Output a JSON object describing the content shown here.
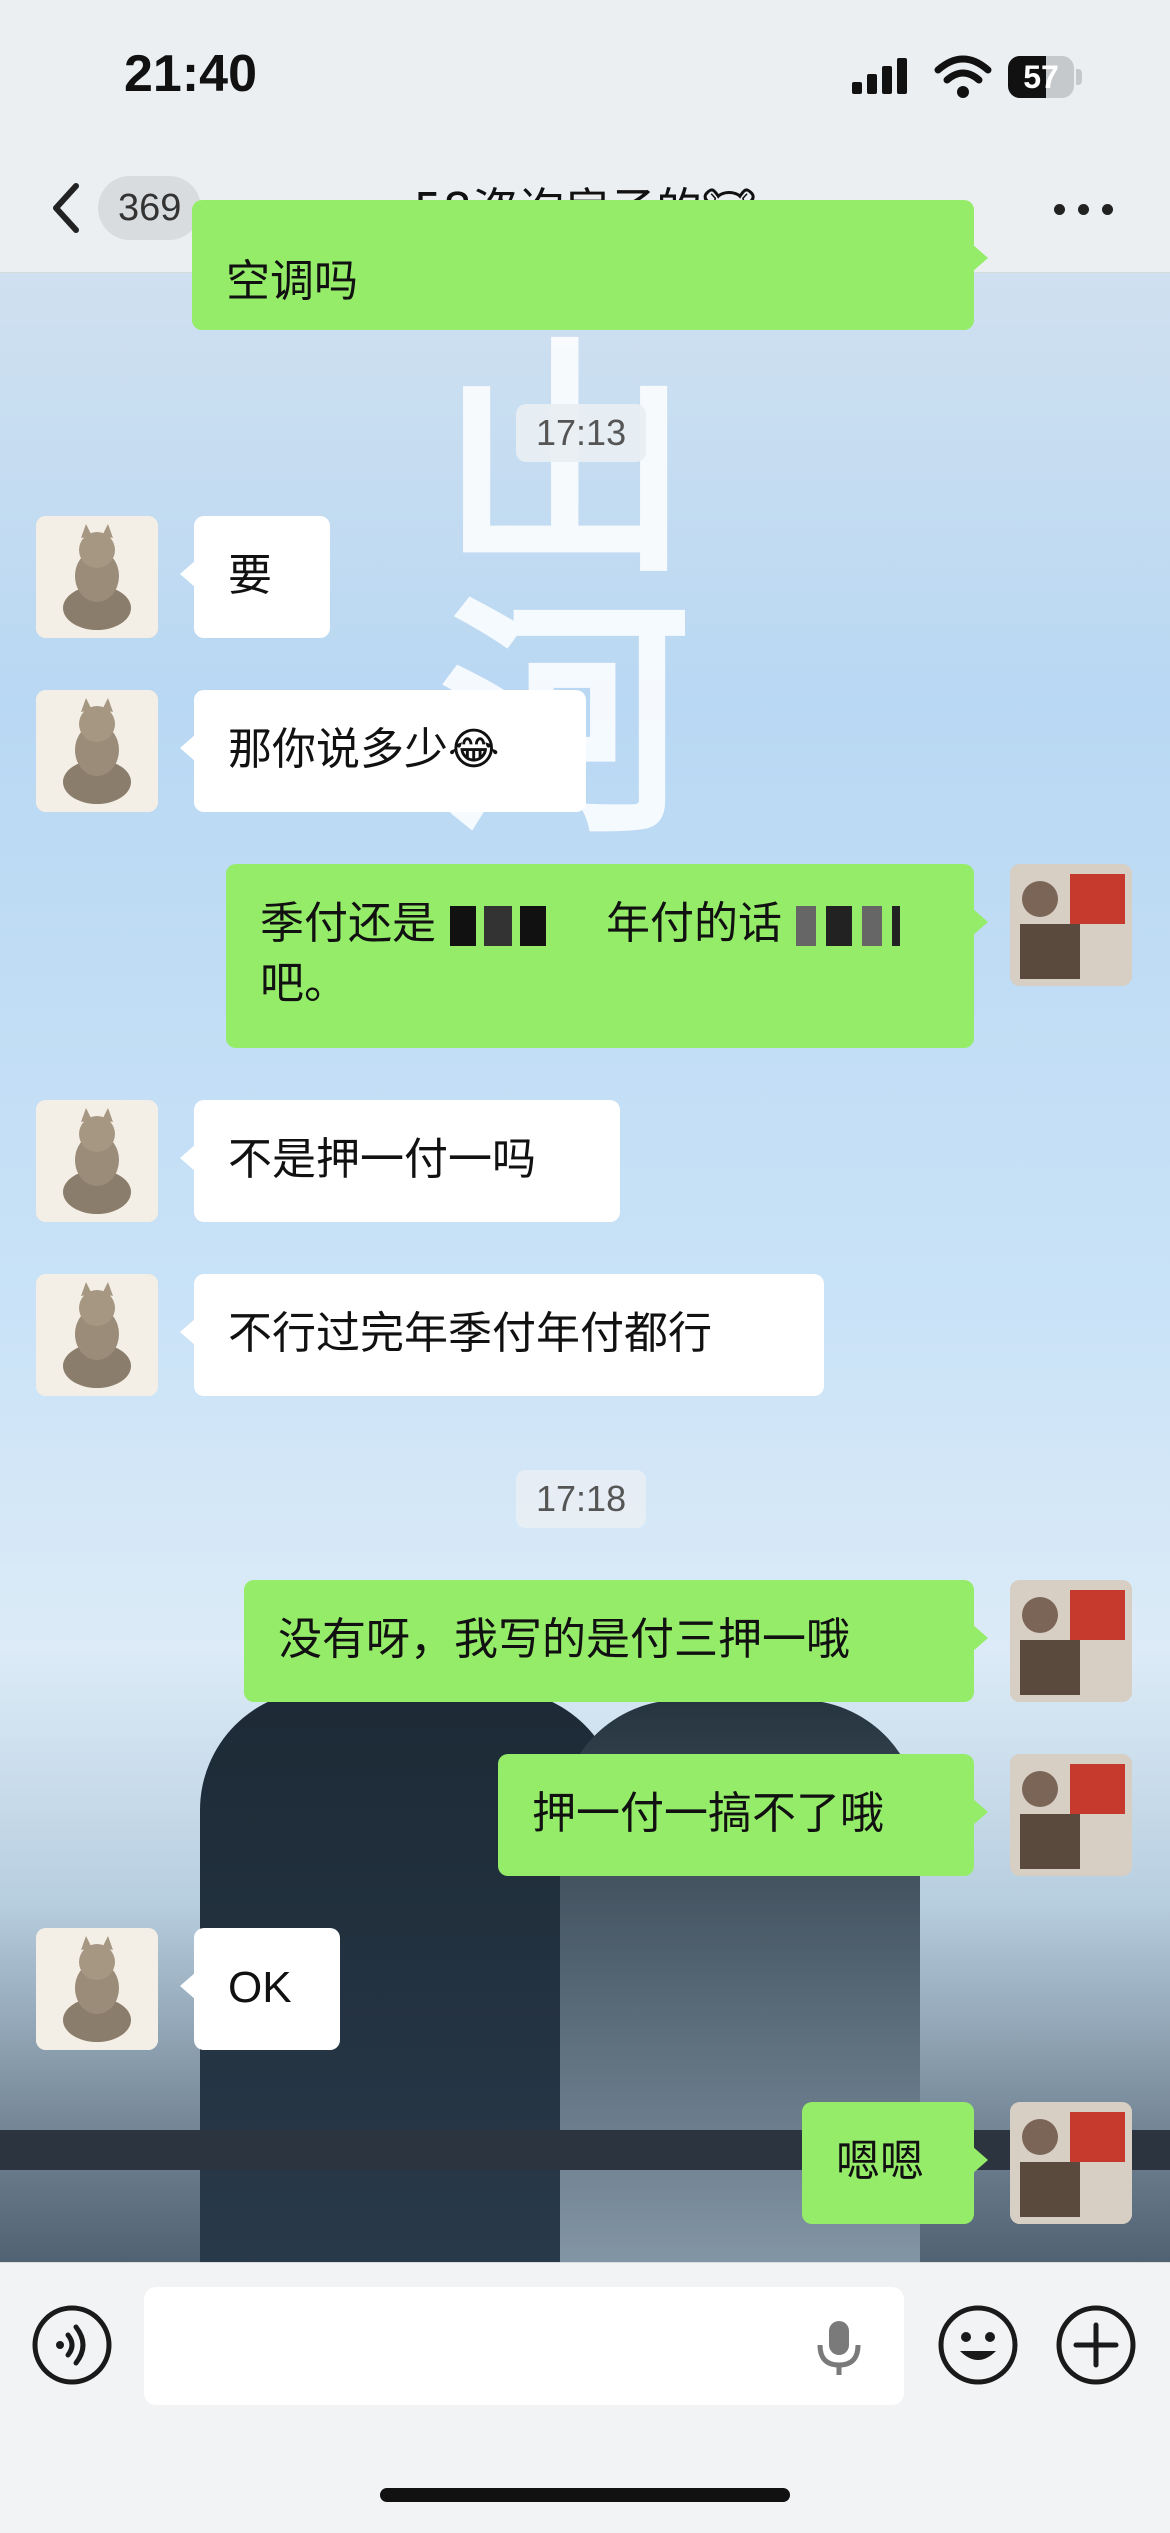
{
  "status_bar": {
    "time": "21:40",
    "battery": "57"
  },
  "header": {
    "unread_count": "369",
    "title": "58咨询房子的🐮"
  },
  "background": {
    "decoration_text": "山河"
  },
  "timestamps": [
    "17:13",
    "17:18"
  ],
  "messages": [
    {
      "side": "out",
      "text": "空调吗"
    },
    {
      "side": "in",
      "text": "要"
    },
    {
      "side": "in",
      "text": "那你说多少😂"
    },
    {
      "side": "out",
      "part1": "季付还是",
      "part2": "年付的话",
      "part3": "吧。"
    },
    {
      "side": "in",
      "text": "不是押一付一吗"
    },
    {
      "side": "in",
      "text": "不行过完年季付年付都行"
    },
    {
      "side": "out",
      "text": "没有呀，我写的是付三押一哦"
    },
    {
      "side": "out",
      "text": "押一付一搞不了哦"
    },
    {
      "side": "in",
      "text": "OK"
    },
    {
      "side": "out",
      "text": "嗯嗯"
    }
  ],
  "input": {
    "placeholder": ""
  },
  "icons": [
    "back-chevron-icon",
    "more-icon",
    "voice-icon",
    "mic-icon",
    "emoji-icon",
    "plus-icon"
  ]
}
